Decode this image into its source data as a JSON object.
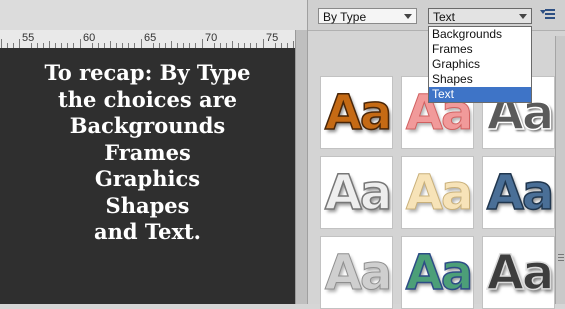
{
  "ruler": {
    "labels": [
      "55",
      "60",
      "65",
      "70",
      "75"
    ]
  },
  "overlay_text": {
    "lines": [
      "To recap: By Type",
      "the choices are",
      "Backgrounds",
      "Frames",
      "Graphics",
      "Shapes",
      "and Text."
    ]
  },
  "panel": {
    "view_select": {
      "value": "By Type"
    },
    "category_select": {
      "value": "Text"
    },
    "menu_icon": "panel-menu-icon",
    "dropdown": {
      "options": [
        "Backgrounds",
        "Frames",
        "Graphics",
        "Shapes",
        "Text"
      ],
      "selected": "Text"
    },
    "styles": [
      {
        "label": "Aa",
        "style": "leopard"
      },
      {
        "label": "Aa",
        "style": "pink"
      },
      {
        "label": "Aa",
        "style": "dark"
      },
      {
        "label": "Aa",
        "style": "chrome"
      },
      {
        "label": "Aa",
        "style": "cream"
      },
      {
        "label": "Aa",
        "style": "denim"
      },
      {
        "label": "Aa",
        "style": "silver"
      },
      {
        "label": "Aa",
        "style": "green"
      },
      {
        "label": "Aa",
        "style": "metal"
      }
    ]
  },
  "colors": {
    "canvas_bg": "#2f2f2f",
    "selection": "#3e74c7",
    "overlay_text": "#ffffff"
  }
}
